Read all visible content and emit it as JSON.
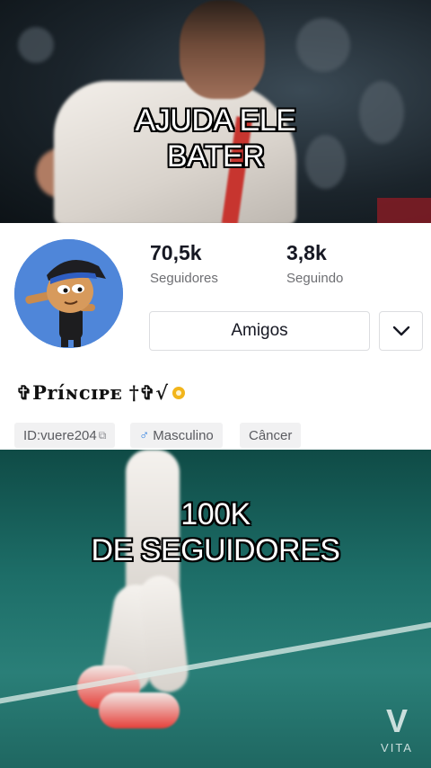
{
  "captions": {
    "top_line1": "AJUDA ELE",
    "top_line2": "BATER",
    "bottom_line1": "100K",
    "bottom_line2": "DE SEGUIDORES"
  },
  "profile": {
    "followers_value": "70,5k",
    "followers_label": "Seguidores",
    "following_value": "3,8k",
    "following_label": "Seguindo",
    "friends_button": "Amigos",
    "more_icon": "chevron-down-icon",
    "name": "✞Príɴcɪᴘᴇ †✞√",
    "verify_icon": "gold-badge-icon",
    "chips": {
      "id": "ID:vuere204",
      "gender_symbol": "♂",
      "gender": "Masculino",
      "sign": "Câncer"
    }
  },
  "watermark": {
    "text": "VITA",
    "logo": "V"
  },
  "colors": {
    "card_bg": "#ffffff",
    "avatar_bg": "#4f86d9",
    "caption_text": "#ffffff",
    "caption_outline": "#000000",
    "male_symbol": "#2f7fe0",
    "badge": "#f2b51b"
  }
}
